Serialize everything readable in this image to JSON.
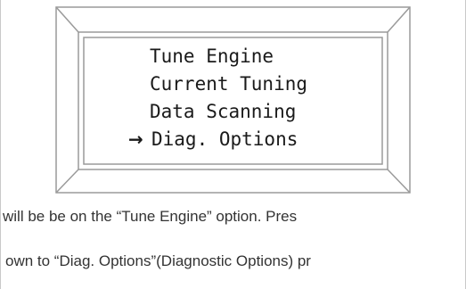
{
  "lcd_menu": {
    "items": [
      {
        "label": "Tune Engine",
        "selected": false
      },
      {
        "label": "Current Tuning",
        "selected": false
      },
      {
        "label": "Data Scanning",
        "selected": false
      },
      {
        "label": "Diag. Options",
        "selected": true
      }
    ],
    "cursor_glyph": "→",
    "cursor_icon": "right-arrow-icon"
  },
  "document_text": {
    "line1": "will be be on the “Tune Engine” option. Pres",
    "line2": "own to “Diag. Options”(Diagnostic Options) pr"
  },
  "colors": {
    "bezel_stroke": "#9a9a9a",
    "text": "#1a1a1a",
    "body_text": "#333333"
  }
}
